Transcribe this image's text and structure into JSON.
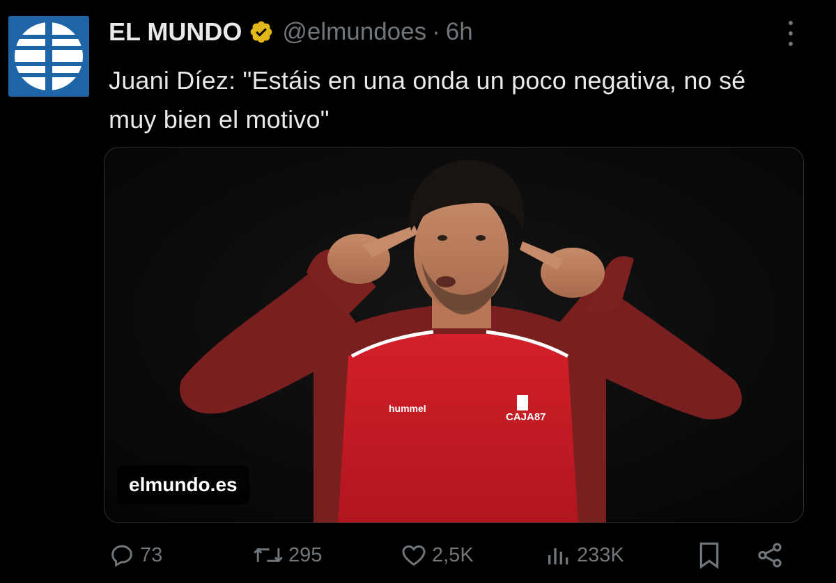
{
  "tweet": {
    "author_name": "EL MUNDO",
    "handle": "@elmundoes",
    "separator": "·",
    "time": "6h",
    "text": "Juani Díez: \"Estáis en una onda un poco negativa, no sé muy bien el motivo\"",
    "verified_color": "#e2b719",
    "brand_color": "#1d65a6"
  },
  "media": {
    "source": "elmundo.es",
    "jersey_brand": "hummel",
    "jersey_sponsor": "CAJA87"
  },
  "actions": {
    "reply_count": "73",
    "retweet_count": "295",
    "like_count": "2,5K",
    "views_count": "233K"
  },
  "icons": {
    "more": "more-options-icon",
    "reply": "reply-icon",
    "retweet": "retweet-icon",
    "like": "heart-icon",
    "views": "views-icon",
    "bookmark": "bookmark-icon",
    "share": "share-icon"
  }
}
